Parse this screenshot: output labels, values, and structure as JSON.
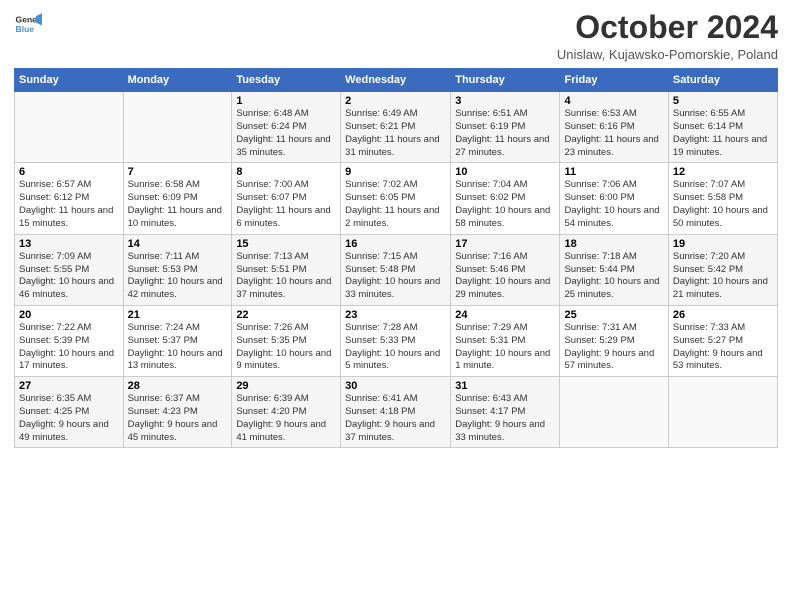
{
  "header": {
    "logo_line1": "General",
    "logo_line2": "Blue",
    "month": "October 2024",
    "location": "Unislaw, Kujawsko-Pomorskie, Poland"
  },
  "weekdays": [
    "Sunday",
    "Monday",
    "Tuesday",
    "Wednesday",
    "Thursday",
    "Friday",
    "Saturday"
  ],
  "weeks": [
    [
      {
        "num": "",
        "info": ""
      },
      {
        "num": "",
        "info": ""
      },
      {
        "num": "1",
        "info": "Sunrise: 6:48 AM\nSunset: 6:24 PM\nDaylight: 11 hours and 35 minutes."
      },
      {
        "num": "2",
        "info": "Sunrise: 6:49 AM\nSunset: 6:21 PM\nDaylight: 11 hours and 31 minutes."
      },
      {
        "num": "3",
        "info": "Sunrise: 6:51 AM\nSunset: 6:19 PM\nDaylight: 11 hours and 27 minutes."
      },
      {
        "num": "4",
        "info": "Sunrise: 6:53 AM\nSunset: 6:16 PM\nDaylight: 11 hours and 23 minutes."
      },
      {
        "num": "5",
        "info": "Sunrise: 6:55 AM\nSunset: 6:14 PM\nDaylight: 11 hours and 19 minutes."
      }
    ],
    [
      {
        "num": "6",
        "info": "Sunrise: 6:57 AM\nSunset: 6:12 PM\nDaylight: 11 hours and 15 minutes."
      },
      {
        "num": "7",
        "info": "Sunrise: 6:58 AM\nSunset: 6:09 PM\nDaylight: 11 hours and 10 minutes."
      },
      {
        "num": "8",
        "info": "Sunrise: 7:00 AM\nSunset: 6:07 PM\nDaylight: 11 hours and 6 minutes."
      },
      {
        "num": "9",
        "info": "Sunrise: 7:02 AM\nSunset: 6:05 PM\nDaylight: 11 hours and 2 minutes."
      },
      {
        "num": "10",
        "info": "Sunrise: 7:04 AM\nSunset: 6:02 PM\nDaylight: 10 hours and 58 minutes."
      },
      {
        "num": "11",
        "info": "Sunrise: 7:06 AM\nSunset: 6:00 PM\nDaylight: 10 hours and 54 minutes."
      },
      {
        "num": "12",
        "info": "Sunrise: 7:07 AM\nSunset: 5:58 PM\nDaylight: 10 hours and 50 minutes."
      }
    ],
    [
      {
        "num": "13",
        "info": "Sunrise: 7:09 AM\nSunset: 5:55 PM\nDaylight: 10 hours and 46 minutes."
      },
      {
        "num": "14",
        "info": "Sunrise: 7:11 AM\nSunset: 5:53 PM\nDaylight: 10 hours and 42 minutes."
      },
      {
        "num": "15",
        "info": "Sunrise: 7:13 AM\nSunset: 5:51 PM\nDaylight: 10 hours and 37 minutes."
      },
      {
        "num": "16",
        "info": "Sunrise: 7:15 AM\nSunset: 5:48 PM\nDaylight: 10 hours and 33 minutes."
      },
      {
        "num": "17",
        "info": "Sunrise: 7:16 AM\nSunset: 5:46 PM\nDaylight: 10 hours and 29 minutes."
      },
      {
        "num": "18",
        "info": "Sunrise: 7:18 AM\nSunset: 5:44 PM\nDaylight: 10 hours and 25 minutes."
      },
      {
        "num": "19",
        "info": "Sunrise: 7:20 AM\nSunset: 5:42 PM\nDaylight: 10 hours and 21 minutes."
      }
    ],
    [
      {
        "num": "20",
        "info": "Sunrise: 7:22 AM\nSunset: 5:39 PM\nDaylight: 10 hours and 17 minutes."
      },
      {
        "num": "21",
        "info": "Sunrise: 7:24 AM\nSunset: 5:37 PM\nDaylight: 10 hours and 13 minutes."
      },
      {
        "num": "22",
        "info": "Sunrise: 7:26 AM\nSunset: 5:35 PM\nDaylight: 10 hours and 9 minutes."
      },
      {
        "num": "23",
        "info": "Sunrise: 7:28 AM\nSunset: 5:33 PM\nDaylight: 10 hours and 5 minutes."
      },
      {
        "num": "24",
        "info": "Sunrise: 7:29 AM\nSunset: 5:31 PM\nDaylight: 10 hours and 1 minute."
      },
      {
        "num": "25",
        "info": "Sunrise: 7:31 AM\nSunset: 5:29 PM\nDaylight: 9 hours and 57 minutes."
      },
      {
        "num": "26",
        "info": "Sunrise: 7:33 AM\nSunset: 5:27 PM\nDaylight: 9 hours and 53 minutes."
      }
    ],
    [
      {
        "num": "27",
        "info": "Sunrise: 6:35 AM\nSunset: 4:25 PM\nDaylight: 9 hours and 49 minutes."
      },
      {
        "num": "28",
        "info": "Sunrise: 6:37 AM\nSunset: 4:23 PM\nDaylight: 9 hours and 45 minutes."
      },
      {
        "num": "29",
        "info": "Sunrise: 6:39 AM\nSunset: 4:20 PM\nDaylight: 9 hours and 41 minutes."
      },
      {
        "num": "30",
        "info": "Sunrise: 6:41 AM\nSunset: 4:18 PM\nDaylight: 9 hours and 37 minutes."
      },
      {
        "num": "31",
        "info": "Sunrise: 6:43 AM\nSunset: 4:17 PM\nDaylight: 9 hours and 33 minutes."
      },
      {
        "num": "",
        "info": ""
      },
      {
        "num": "",
        "info": ""
      }
    ]
  ]
}
